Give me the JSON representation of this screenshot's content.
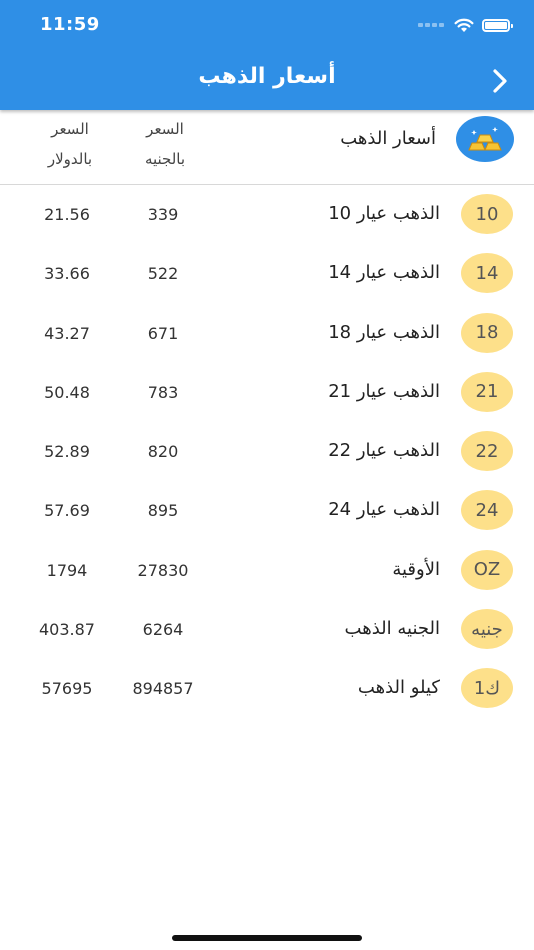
{
  "status_bar": {
    "time": "11:59"
  },
  "nav": {
    "title": "أسعار الذهب"
  },
  "header": {
    "title": "أسعار الذهب",
    "col_egp": "السعر\nبالجنيه",
    "col_usd": "السعر\nبالدولار"
  },
  "rows": [
    {
      "badge": "10",
      "name": "الذهب عيار 10",
      "egp": "339",
      "usd": "21.56"
    },
    {
      "badge": "14",
      "name": "الذهب عيار 14",
      "egp": "522",
      "usd": "33.66"
    },
    {
      "badge": "18",
      "name": "الذهب عيار 18",
      "egp": "671",
      "usd": "43.27"
    },
    {
      "badge": "21",
      "name": "الذهب عيار 21",
      "egp": "783",
      "usd": "50.48"
    },
    {
      "badge": "22",
      "name": "الذهب عيار 22",
      "egp": "820",
      "usd": "52.89"
    },
    {
      "badge": "24",
      "name": "الذهب عيار 24",
      "egp": "895",
      "usd": "57.69"
    },
    {
      "badge": "OZ",
      "name": "الأوقية",
      "egp": "27830",
      "usd": "1794"
    },
    {
      "badge": "جنيه",
      "name": "الجنيه الذهب",
      "egp": "6264",
      "usd": "403.87"
    },
    {
      "badge": "1ك",
      "name": "كيلو الذهب",
      "egp": "894857",
      "usd": "57695"
    }
  ],
  "colors": {
    "primary": "#2f8fe6",
    "badge": "#fde08a"
  },
  "icons": {
    "back": "chevron-right-icon",
    "logo": "gold-bars-icon",
    "wifi": "wifi-icon",
    "battery": "battery-icon"
  }
}
